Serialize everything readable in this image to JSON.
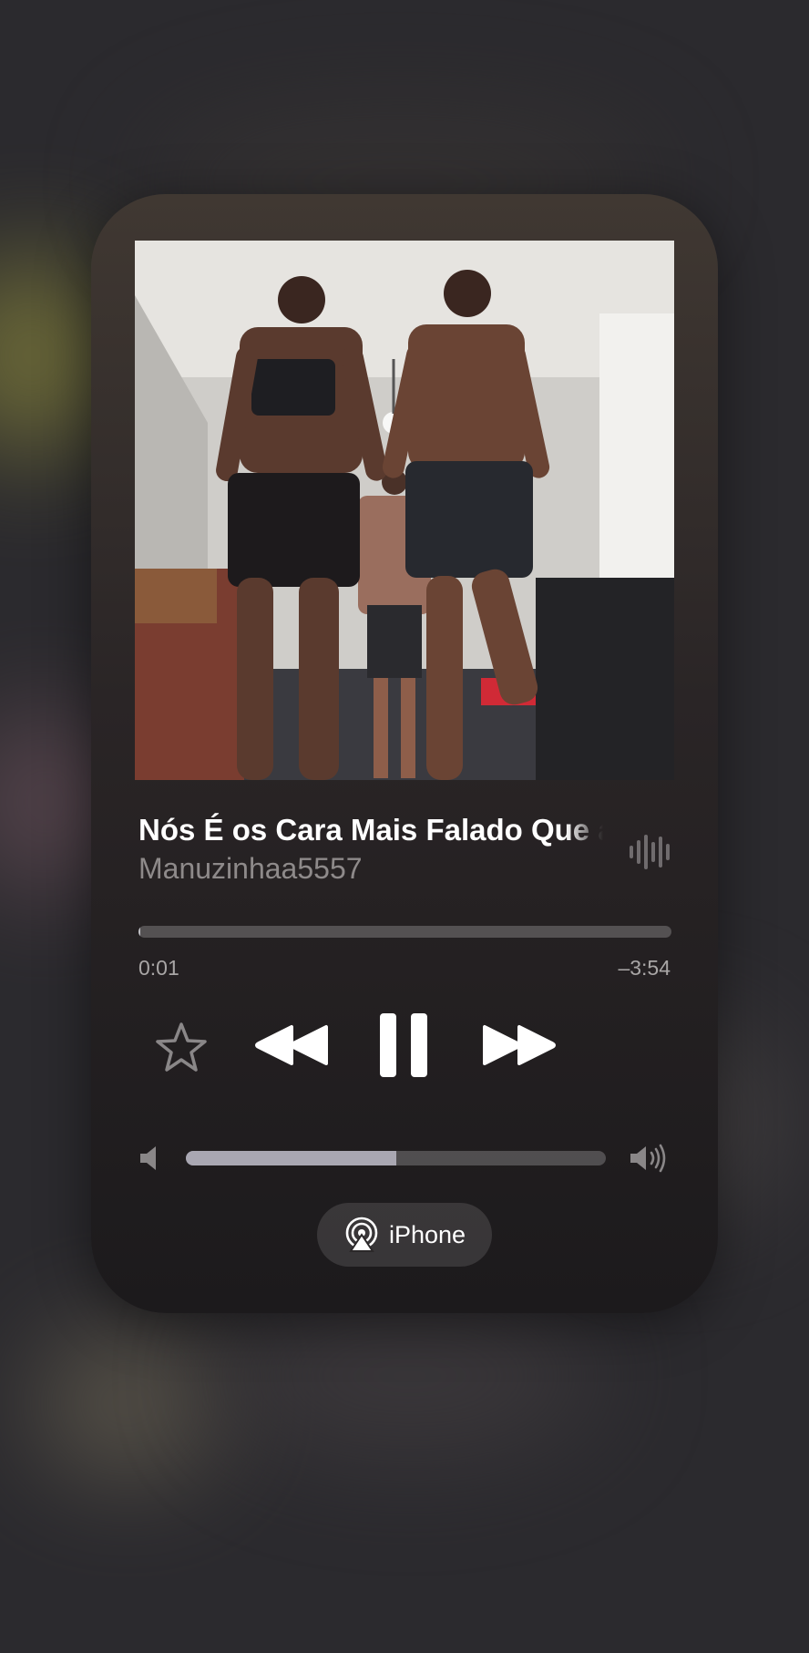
{
  "now_playing": {
    "title": "Nós É os Cara Mais Falado Que as",
    "artist": "Manuzinhaa5557",
    "artwork_icon": "album-artwork-photo"
  },
  "playback": {
    "elapsed": "0:01",
    "remaining": "–3:54",
    "progress_fraction": 0.004,
    "state_icon": "pause-icon"
  },
  "volume": {
    "level_fraction": 0.5
  },
  "output_device": {
    "label": "iPhone",
    "icon": "airplay-icon"
  },
  "colors": {
    "card_top": "#403832",
    "card_bottom": "#1c1a1c",
    "progress_fill": "#bfbfc4",
    "volume_fill": "#a9a7b2",
    "secondary_text": "#8e8a8a"
  }
}
